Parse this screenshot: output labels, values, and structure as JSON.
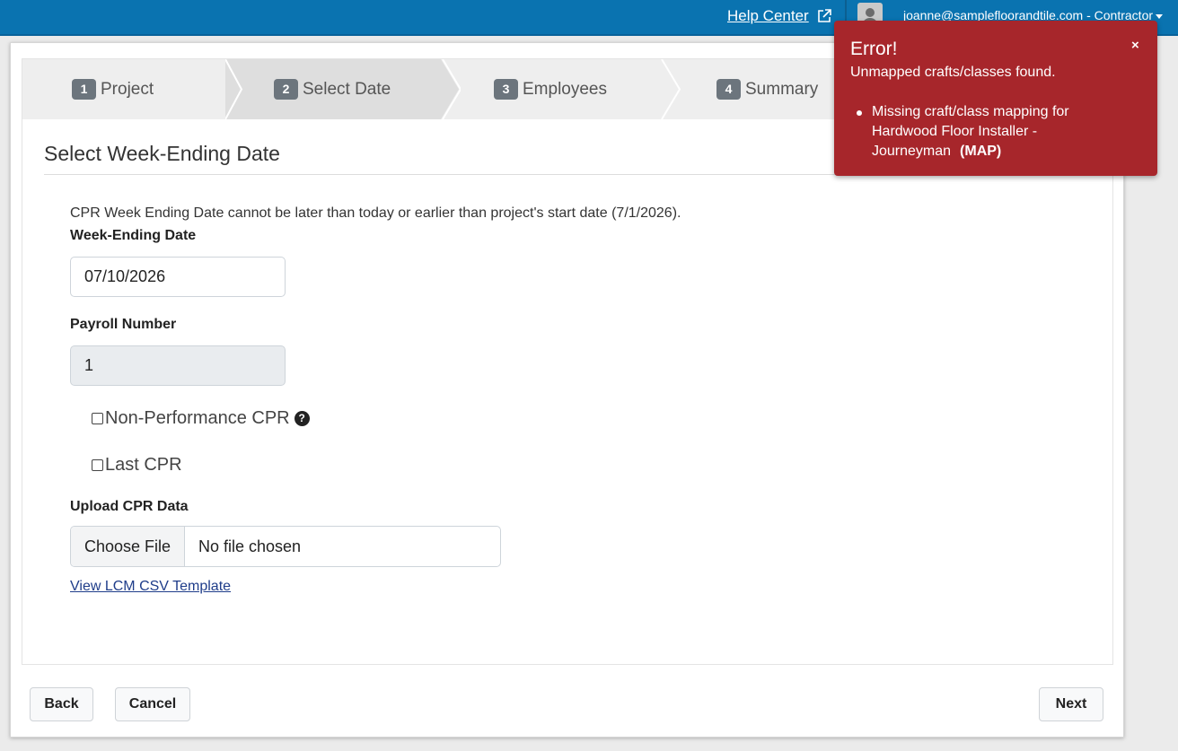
{
  "header": {
    "help_center_label": "Help Center",
    "user_label": "joanne@samplefloorandtile.com - Contractor"
  },
  "stepper": {
    "steps": [
      {
        "number": "1",
        "label": "Project"
      },
      {
        "number": "2",
        "label": "Select Date"
      },
      {
        "number": "3",
        "label": "Employees"
      },
      {
        "number": "4",
        "label": "Summary"
      }
    ],
    "active_step": 2
  },
  "form": {
    "section_title": "Select Week-Ending Date",
    "help_text": "CPR Week Ending Date cannot be later than today or earlier than project's start date (7/1/2026).",
    "week_ending": {
      "label": "Week-Ending Date",
      "value": "07/10/2026"
    },
    "payroll": {
      "label": "Payroll Number",
      "value": "1"
    },
    "non_performance": {
      "label": "Non-Performance CPR",
      "checked": false,
      "help_icon": "question-circle-icon"
    },
    "last_cpr": {
      "label": "Last CPR",
      "checked": false
    },
    "upload": {
      "label": "Upload CPR Data",
      "button_label": "Choose File",
      "status": "No file chosen"
    },
    "template_link": "View LCM CSV Template"
  },
  "footer": {
    "back_label": "Back",
    "cancel_label": "Cancel",
    "next_label": "Next"
  },
  "toast": {
    "title": "Error!",
    "close_label": "×",
    "message": "Unmapped crafts/classes found.",
    "items": [
      {
        "text": "Missing craft/class mapping for Hardwood Floor Installer - Journeyman",
        "link": "(MAP)"
      }
    ],
    "color": "#a7262b"
  },
  "colors": {
    "topbar": "#0a73b0",
    "badge": "#6c757d",
    "link": "#1f3d8a"
  }
}
